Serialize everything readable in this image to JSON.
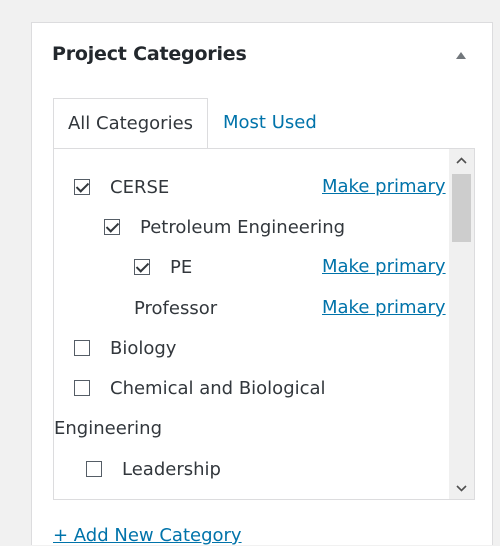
{
  "panel": {
    "title": "Project Categories",
    "tabs": {
      "all": "All Categories",
      "most_used": "Most Used"
    },
    "categories": [
      {
        "label": "CERSE",
        "checked": true,
        "primary_link": "Make primary"
      },
      {
        "label": "Petroleum Engineering",
        "checked": true
      },
      {
        "label": "PE",
        "checked": true,
        "primary_link": "Make primary"
      },
      {
        "label": "Professor",
        "primary_link": "Make primary"
      },
      {
        "label": "Biology",
        "checked": false
      },
      {
        "label": "Chemical and Biological",
        "checked": false
      },
      {
        "label": "Engineering"
      },
      {
        "label": "Leadership",
        "checked": false
      }
    ],
    "add_new": "+ Add New Category"
  },
  "colors": {
    "link": "#0073aa",
    "text": "#32373c",
    "border": "#dcdcde",
    "background": "#f1f1f1"
  },
  "icons": {
    "toggle": "triangle-up-icon",
    "checkbox": "checkbox-icon",
    "scroll_up": "chevron-up-icon",
    "scroll_down": "chevron-down-icon"
  }
}
